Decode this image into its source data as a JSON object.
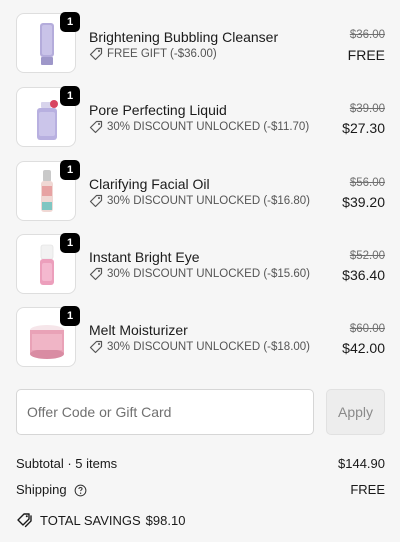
{
  "cart": {
    "items": [
      {
        "name": "Brightening Bubbling Cleanser",
        "quantity": "1",
        "promo_icon": "tag-icon",
        "promo": "FREE GIFT (-$36.00)",
        "original_price": "$36.00",
        "price": "FREE"
      },
      {
        "name": "Pore Perfecting Liquid",
        "quantity": "1",
        "promo_icon": "tag-icon",
        "promo": "30% DISCOUNT UNLOCKED (-$11.70)",
        "original_price": "$39.00",
        "price": "$27.30"
      },
      {
        "name": "Clarifying Facial Oil",
        "quantity": "1",
        "promo_icon": "tag-icon",
        "promo": "30% DISCOUNT UNLOCKED (-$16.80)",
        "original_price": "$56.00",
        "price": "$39.20"
      },
      {
        "name": "Instant Bright Eye",
        "quantity": "1",
        "promo_icon": "tag-icon",
        "promo": "30% DISCOUNT UNLOCKED (-$15.60)",
        "original_price": "$52.00",
        "price": "$36.40"
      },
      {
        "name": "Melt Moisturizer",
        "quantity": "1",
        "promo_icon": "tag-icon",
        "promo": "30% DISCOUNT UNLOCKED (-$18.00)",
        "original_price": "$60.00",
        "price": "$42.00"
      }
    ]
  },
  "offer": {
    "placeholder": "Offer Code or Gift Card",
    "value": "",
    "apply_label": "Apply"
  },
  "summary": {
    "subtotal_label": "Subtotal · 5 items",
    "subtotal_value": "$144.90",
    "shipping_label": "Shipping",
    "shipping_help_icon": "question-circle-icon",
    "shipping_value": "FREE",
    "savings_icon": "tags-icon",
    "savings_label": "TOTAL SAVINGS",
    "savings_value": "$98.10"
  },
  "colors": {
    "background": "#f6f6f6",
    "badge": "#000000",
    "apply_disabled": "#ededed"
  }
}
